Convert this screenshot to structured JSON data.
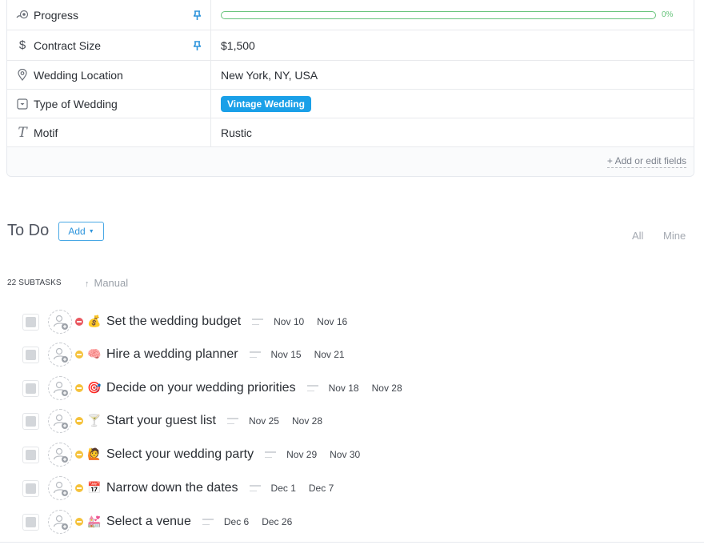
{
  "fields": [
    {
      "label": "Progress",
      "icon": "progress-icon",
      "pinned": true,
      "type": "progress",
      "value": "0%",
      "progress": 0
    },
    {
      "label": "Contract Size",
      "icon": "dollar-icon",
      "pinned": true,
      "type": "text",
      "value": "$1,500"
    },
    {
      "label": "Wedding Location",
      "icon": "location-pin-icon",
      "pinned": false,
      "type": "text",
      "value": "New York, NY, USA"
    },
    {
      "label": "Type of Wedding",
      "icon": "dropdown-icon",
      "pinned": false,
      "type": "tag",
      "value": "Vintage Wedding",
      "tag_color": "#1aa0e8"
    },
    {
      "label": "Motif",
      "icon": "text-icon",
      "pinned": false,
      "type": "text",
      "value": "Rustic"
    }
  ],
  "edit_fields_label": "+ Add or edit fields",
  "todo": {
    "title": "To Do",
    "add_label": "Add",
    "filter_all": "All",
    "filter_mine": "Mine",
    "subtask_count": "22 SUBTASKS",
    "sort_label": "Manual"
  },
  "colors": {
    "progress_green": "#66c37a",
    "accent_blue": "#1aa0e8",
    "priority_urgent": "#e9575f",
    "priority_normal": "#f5c23b"
  },
  "tasks": [
    {
      "name": "Set the wedding budget",
      "emoji": "💰",
      "emoji_name": "money-bag-icon",
      "priority": "urgent",
      "start": "Nov 10",
      "due": "Nov 16"
    },
    {
      "name": "Hire a wedding planner",
      "emoji": "🧠",
      "emoji_name": "brain-icon",
      "priority": "normal",
      "start": "Nov 15",
      "due": "Nov 21"
    },
    {
      "name": "Decide on your wedding priorities",
      "emoji": "🎯",
      "emoji_name": "target-icon",
      "priority": "normal",
      "start": "Nov 18",
      "due": "Nov 28"
    },
    {
      "name": "Start your guest list",
      "emoji": "🍸",
      "emoji_name": "cocktail-icon",
      "priority": "normal",
      "start": "Nov 25",
      "due": "Nov 28"
    },
    {
      "name": "Select your wedding party",
      "emoji": "🙋",
      "emoji_name": "raising-hand-icon",
      "priority": "normal",
      "start": "Nov 29",
      "due": "Nov 30"
    },
    {
      "name": "Narrow down the dates",
      "emoji": "📅",
      "emoji_name": "calendar-icon",
      "priority": "normal",
      "start": "Dec 1",
      "due": "Dec 7"
    },
    {
      "name": "Select a venue",
      "emoji": "💒",
      "emoji_name": "wedding-chapel-icon",
      "priority": "normal",
      "start": "Dec 6",
      "due": "Dec 26"
    }
  ]
}
